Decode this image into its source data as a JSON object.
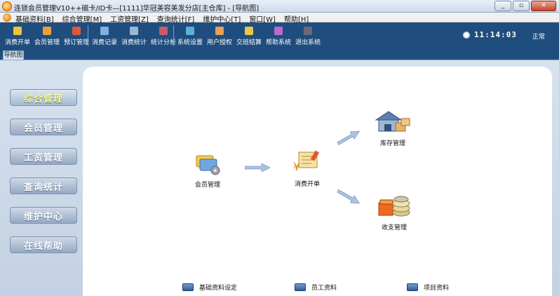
{
  "window": {
    "title": "连锁会员管理V10++磁卡/ID卡—[1111]华冠美容美发分店[主仓库] - [导航图]",
    "controls": [
      "_",
      "▫",
      "✕"
    ]
  },
  "menubar": {
    "items": [
      "基础资料[B]",
      "综合管理[M]",
      "工资管理[Z]",
      "查询统计[F]",
      "维护中心[T]",
      "窗口[W]",
      "帮助[H]"
    ]
  },
  "toolbar": {
    "group1": [
      {
        "label": "消费开单",
        "icon": "bill-icon",
        "color": "#f0c23a"
      },
      {
        "label": "会员管理",
        "icon": "members-icon",
        "color": "#e9a23b"
      },
      {
        "label": "预订管理",
        "icon": "reservation-icon",
        "color": "#d95a3a"
      }
    ],
    "group2": [
      {
        "label": "消费记录",
        "icon": "records-icon",
        "color": "#7fb2e0"
      },
      {
        "label": "消费统计",
        "icon": "stats-icon",
        "color": "#9bb7d6"
      },
      {
        "label": "统计分析",
        "icon": "analysis-icon",
        "color": "#c95a6a"
      }
    ],
    "group3": [
      {
        "label": "系统设置",
        "icon": "settings-icon",
        "color": "#5fb0d8"
      },
      {
        "label": "用户授权",
        "icon": "authorize-icon",
        "color": "#e8a05a"
      },
      {
        "label": "交班结算",
        "icon": "shift-icon",
        "color": "#e7c84a"
      },
      {
        "label": "帮助系统",
        "icon": "help-icon",
        "color": "#b86ad0"
      },
      {
        "label": "退出系统",
        "icon": "exit-icon",
        "color": "#6a6a7a"
      }
    ],
    "clock": "11:14:03",
    "status": "正常"
  },
  "navtab": {
    "label": "导航图"
  },
  "sidebar": {
    "items": [
      "综合管理",
      "会员管理",
      "工资管理",
      "查询统计",
      "维护中心",
      "在线帮助"
    ]
  },
  "diagram": {
    "nodes": {
      "members": "会员管理",
      "bill": "消费开单",
      "inventory": "库存管理",
      "finance": "收支管理"
    }
  },
  "bottom_links": [
    "基础资料设定",
    "员工资料",
    "项目资料"
  ]
}
